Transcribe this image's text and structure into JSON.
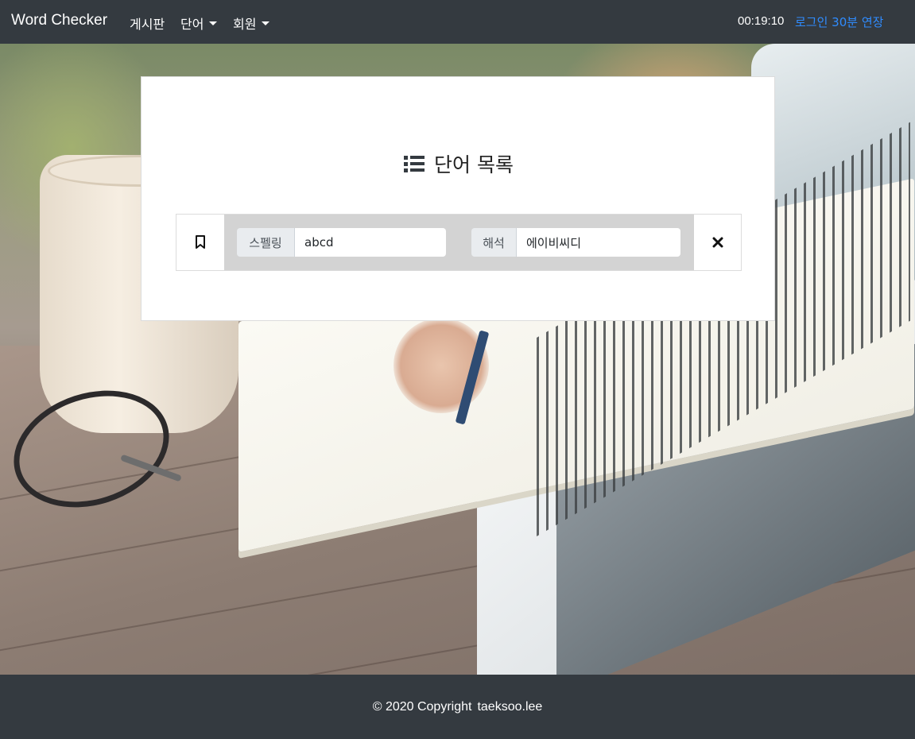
{
  "navbar": {
    "brand": "Word Checker",
    "menu": [
      {
        "label": "게시판",
        "dropdown": false
      },
      {
        "label": "단어",
        "dropdown": true
      },
      {
        "label": "회원",
        "dropdown": true
      }
    ],
    "timer": "00:19:10",
    "extend_label": "로그인 30분 연장"
  },
  "card": {
    "title": "단어 목록",
    "title_icon": "list-icon",
    "words": [
      {
        "bookmark_icon": "bookmark-icon",
        "spelling_label": "스펠링",
        "spelling_value": "abcd",
        "meaning_label": "해석",
        "meaning_value": "에이비씨디",
        "delete_icon": "close-icon"
      }
    ]
  },
  "footer": {
    "copyright": "© 2020 Copyright",
    "author": "taeksoo.lee"
  },
  "colors": {
    "navbar_bg": "#343a40",
    "link_accent": "#2f8cff",
    "row_gray": "#d3d3d3",
    "addon_bg": "#e9ecef"
  }
}
